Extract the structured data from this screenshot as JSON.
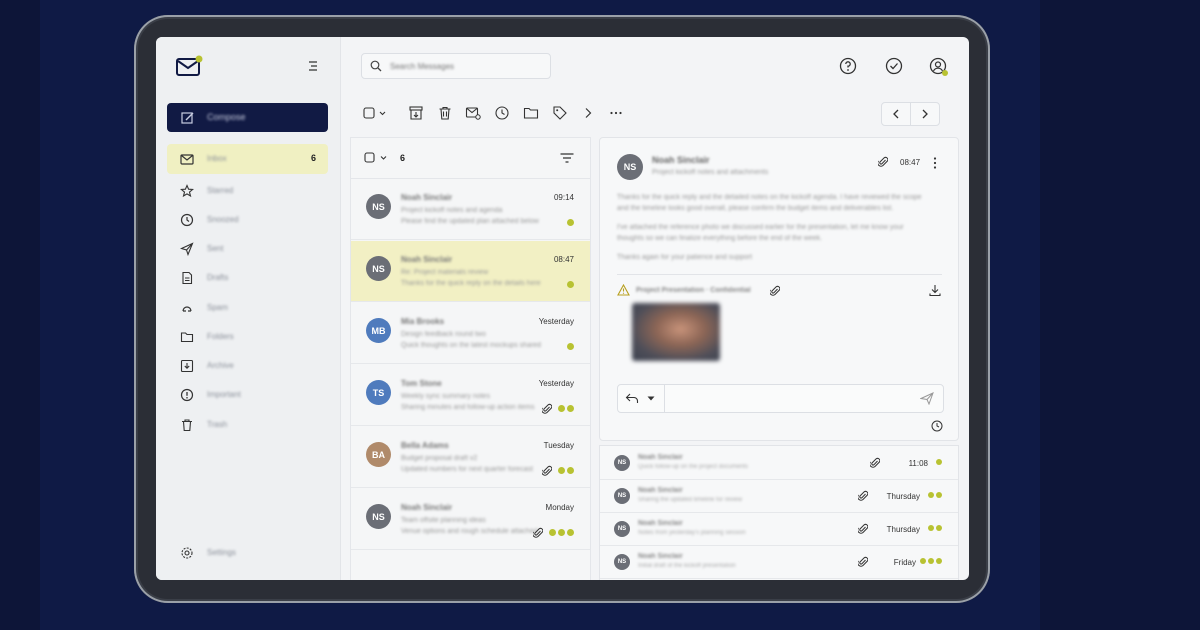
{
  "app": {
    "accent": "#b8c232",
    "dark": "#111a44"
  },
  "sidebar": {
    "compose_label": "Compose",
    "items": [
      {
        "label": "Inbox",
        "count": "6",
        "icon": "mail-icon"
      },
      {
        "label": "Starred",
        "icon": "star-icon"
      },
      {
        "label": "Snoozed",
        "icon": "clock-icon"
      },
      {
        "label": "Sent",
        "icon": "send-icon"
      },
      {
        "label": "Drafts",
        "icon": "draft-icon"
      },
      {
        "label": "Spam",
        "icon": "spam-icon"
      },
      {
        "label": "Folders",
        "icon": "folder-icon"
      },
      {
        "label": "Archive",
        "icon": "archive-icon"
      },
      {
        "label": "Important",
        "icon": "alert-icon"
      },
      {
        "label": "Trash",
        "icon": "trash-icon"
      }
    ],
    "settings_label": "Settings"
  },
  "search": {
    "placeholder": "Search Messages"
  },
  "list": {
    "selected_count": "6",
    "messages": [
      {
        "initials": "NS",
        "color": "#6b6e76",
        "sender": "Noah Sinclair",
        "line1": "Project kickoff notes and agenda",
        "line2": "Please find the updated plan attached below",
        "time": "09:14",
        "dots": 1,
        "attachment": false
      },
      {
        "initials": "NS",
        "color": "#6b6e76",
        "sender": "Noah Sinclair",
        "line1": "Re: Project materials review",
        "line2": "Thanks for the quick reply on the details here",
        "time": "08:47",
        "dots": 1,
        "attachment": false
      },
      {
        "initials": "MB",
        "color": "#4f7bbd",
        "sender": "Mia Brooks",
        "line1": "Design feedback round two",
        "line2": "Quick thoughts on the latest mockups shared",
        "time": "Yesterday",
        "dots": 1,
        "attachment": false
      },
      {
        "initials": "TS",
        "color": "#4f7bbd",
        "sender": "Tom Stone",
        "line1": "Weekly sync summary notes",
        "line2": "Sharing minutes and follow-up action items",
        "time": "Yesterday",
        "dots": 2,
        "attachment": true
      },
      {
        "initials": "BA",
        "color": "#b08a6a",
        "sender": "Bella Adams",
        "line1": "Budget proposal draft v2",
        "line2": "Updated numbers for next quarter forecast",
        "time": "Tuesday",
        "dots": 2,
        "attachment": true
      },
      {
        "initials": "NS",
        "color": "#6b6e76",
        "sender": "Noah Sinclair",
        "line1": "Team offsite planning ideas",
        "line2": "Venue options and rough schedule attached",
        "time": "Monday",
        "dots": 3,
        "attachment": true
      }
    ]
  },
  "reader": {
    "initials": "NS",
    "sender": "Noah Sinclair",
    "subject": "Project kickoff notes and attachments",
    "time": "08:47",
    "body": [
      "Thanks for the quick reply and the detailed notes on the kickoff agenda. I have reviewed the scope",
      "and the timeline looks good overall, please confirm the budget items and deliverables list.",
      "I've attached the reference photo we discussed earlier for the presentation, let me know your",
      "thoughts so we can finalize everything before the end of the week.",
      "Thanks again for your patience and support"
    ],
    "attachment_name": "Project Presentation · Confidential"
  },
  "thread": [
    {
      "initials": "NS",
      "sender": "Noah Sinclair",
      "sub": "Quick follow-up on the project documents",
      "time": "11:08",
      "dots": 1
    },
    {
      "initials": "NS",
      "sender": "Noah Sinclair",
      "sub": "Sharing the updated timeline for review",
      "time": "Thursday",
      "dots": 2
    },
    {
      "initials": "NS",
      "sender": "Noah Sinclair",
      "sub": "Notes from yesterday's planning session",
      "time": "Thursday",
      "dots": 2
    },
    {
      "initials": "NS",
      "sender": "Noah Sinclair",
      "sub": "Initial draft of the kickoff presentation",
      "time": "Friday",
      "dots": 3
    }
  ]
}
